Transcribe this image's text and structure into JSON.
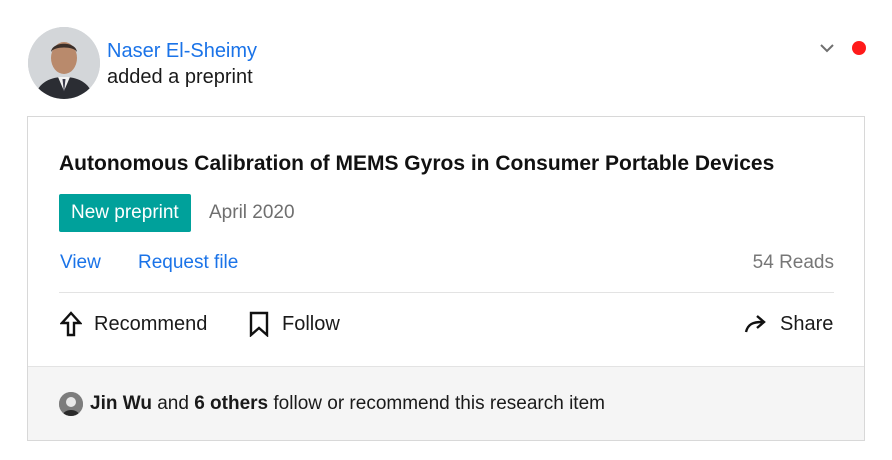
{
  "post": {
    "author": "Naser El-Sheimy",
    "action": "added a preprint"
  },
  "card": {
    "title": "Autonomous Calibration of MEMS Gyros in Consumer Portable Devices",
    "badge": "New preprint",
    "date": "April 2020",
    "view_label": "View",
    "request_label": "Request file",
    "reads": "54 Reads",
    "recommend_label": "Recommend",
    "follow_label": "Follow",
    "share_label": "Share"
  },
  "footer": {
    "name": "Jin Wu",
    "connector": "and",
    "others": "6 others",
    "suffix": "follow or recommend this research item"
  },
  "colors": {
    "link": "#1a73e8",
    "badge": "#00a19b",
    "notification_dot": "#ff1a1a"
  },
  "icons": [
    "chevron-down-icon",
    "notification-dot",
    "recommend-arrow-icon",
    "bookmark-icon",
    "share-arrow-icon"
  ]
}
